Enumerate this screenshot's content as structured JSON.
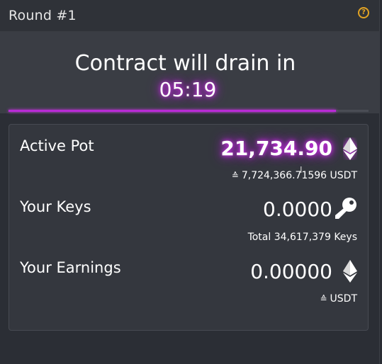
{
  "header": {
    "round_title": "Round #1",
    "help_icon": "question-circle-icon",
    "help_glyph": "?"
  },
  "drain": {
    "label": "Contract will drain in",
    "timer": "05:19",
    "progress_fraction": 0.91
  },
  "stats": {
    "active_pot": {
      "label": "Active Pot",
      "value": "21,734.90",
      "icon": "ethereum-icon",
      "sub_prefix": "≙",
      "sub_value": "7,724,366.71596 USDT"
    },
    "your_keys": {
      "label": "Your Keys",
      "value": "0.0000",
      "icon": "key-icon",
      "sub_value": "Total 34,617,379 Keys"
    },
    "your_earnings": {
      "label": "Your Earnings",
      "value": "0.00000",
      "icon": "ethereum-icon",
      "sub_prefix": "≙",
      "sub_value": "USDT"
    }
  },
  "colors": {
    "accent_purple": "#b92bd6",
    "help_yellow": "#e2a323",
    "background": "#2b2e35",
    "panel": "#3a3d44",
    "card": "#34373e"
  }
}
